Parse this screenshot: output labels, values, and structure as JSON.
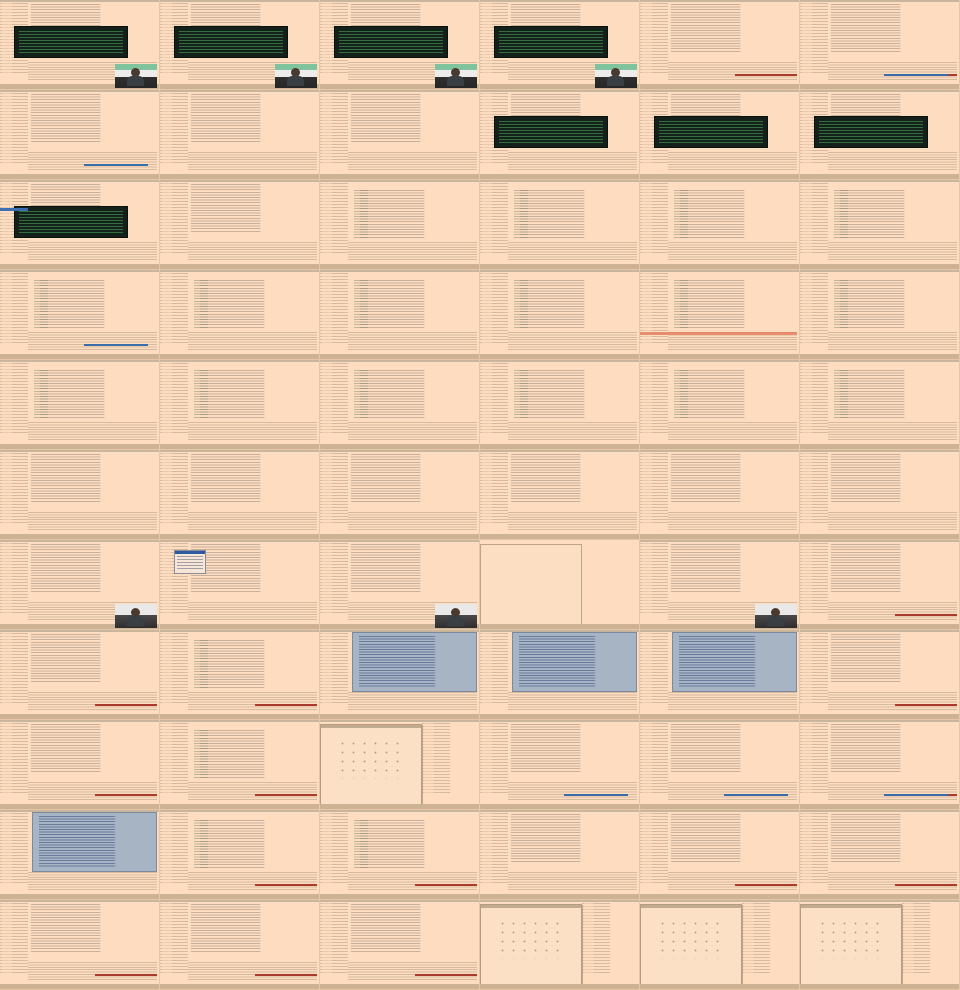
{
  "sheet": {
    "columns": 6,
    "rows": 11,
    "frames": [
      {
        "kind": "ide-terminal",
        "overlay": "video-green"
      },
      {
        "kind": "ide-terminal",
        "overlay": "video-green"
      },
      {
        "kind": "ide-terminal",
        "overlay": "video-green"
      },
      {
        "kind": "ide-terminal",
        "overlay": "video-green"
      },
      {
        "kind": "ide",
        "overlay": "progress-red"
      },
      {
        "kind": "ide",
        "overlay": "progress-red-blue"
      },
      {
        "kind": "ide",
        "overlay": "progress-blue"
      },
      {
        "kind": "ide",
        "overlay": "none"
      },
      {
        "kind": "ide",
        "overlay": "none"
      },
      {
        "kind": "ide-terminal",
        "overlay": "none"
      },
      {
        "kind": "ide-terminal",
        "overlay": "none"
      },
      {
        "kind": "ide-terminal",
        "overlay": "none"
      },
      {
        "kind": "ide-terminal",
        "overlay": "sel-blue"
      },
      {
        "kind": "ide",
        "overlay": "none"
      },
      {
        "kind": "ide-code",
        "overlay": "none"
      },
      {
        "kind": "ide-code",
        "overlay": "none"
      },
      {
        "kind": "ide-code",
        "overlay": "none"
      },
      {
        "kind": "ide-code",
        "overlay": "none"
      },
      {
        "kind": "ide-code",
        "overlay": "progress-blue"
      },
      {
        "kind": "ide-code",
        "overlay": "none"
      },
      {
        "kind": "ide-code",
        "overlay": "none"
      },
      {
        "kind": "ide-code",
        "overlay": "none"
      },
      {
        "kind": "ide-code",
        "overlay": "caret-red"
      },
      {
        "kind": "ide-code",
        "overlay": "none"
      },
      {
        "kind": "ide-code",
        "overlay": "none"
      },
      {
        "kind": "ide-code",
        "overlay": "none"
      },
      {
        "kind": "ide-code",
        "overlay": "none"
      },
      {
        "kind": "ide-code",
        "overlay": "none"
      },
      {
        "kind": "ide-code",
        "overlay": "none"
      },
      {
        "kind": "ide-code",
        "overlay": "none"
      },
      {
        "kind": "ide",
        "overlay": "none"
      },
      {
        "kind": "ide",
        "overlay": "none"
      },
      {
        "kind": "ide",
        "overlay": "none"
      },
      {
        "kind": "ide",
        "overlay": "none"
      },
      {
        "kind": "ide",
        "overlay": "none"
      },
      {
        "kind": "ide",
        "overlay": "none"
      },
      {
        "kind": "ide",
        "overlay": "video"
      },
      {
        "kind": "ide",
        "overlay": "dropdown-video"
      },
      {
        "kind": "ide",
        "overlay": "video"
      },
      {
        "kind": "dialog-plain",
        "overlay": "none"
      },
      {
        "kind": "ide",
        "overlay": "video"
      },
      {
        "kind": "ide",
        "overlay": "progress-red"
      },
      {
        "kind": "ide",
        "overlay": "progress-red"
      },
      {
        "kind": "ide-code",
        "overlay": "progress-red"
      },
      {
        "kind": "ide-code",
        "overlay": "blue-editor"
      },
      {
        "kind": "ide-code",
        "overlay": "blue-editor"
      },
      {
        "kind": "ide-code",
        "overlay": "blue-editor"
      },
      {
        "kind": "ide",
        "overlay": "progress-red"
      },
      {
        "kind": "ide",
        "overlay": "progress-red"
      },
      {
        "kind": "ide-code",
        "overlay": "progress-red"
      },
      {
        "kind": "dialog",
        "overlay": "none"
      },
      {
        "kind": "ide",
        "overlay": "progress-blue"
      },
      {
        "kind": "ide",
        "overlay": "progress-blue"
      },
      {
        "kind": "ide",
        "overlay": "progress-red-blue"
      },
      {
        "kind": "ide-code",
        "overlay": "blue-editor"
      },
      {
        "kind": "ide-code",
        "overlay": "progress-red"
      },
      {
        "kind": "ide-code",
        "overlay": "progress-red"
      },
      {
        "kind": "ide",
        "overlay": "none"
      },
      {
        "kind": "ide",
        "overlay": "progress-red"
      },
      {
        "kind": "ide",
        "overlay": "progress-red"
      },
      {
        "kind": "ide",
        "overlay": "progress-red"
      },
      {
        "kind": "ide",
        "overlay": "progress-red"
      },
      {
        "kind": "ide",
        "overlay": "progress-red"
      },
      {
        "kind": "dialog",
        "overlay": "none"
      },
      {
        "kind": "dialog",
        "overlay": "none"
      },
      {
        "kind": "dialog",
        "overlay": "none"
      }
    ]
  },
  "colors": {
    "page_bg": "#fddcbf",
    "terminal_bg": "#14201a",
    "terminal_text": "#3f8f4e",
    "progress_red": "#a83b2b",
    "progress_blue": "#3a6ea8",
    "overlay_blue": "#a6b4c4"
  }
}
